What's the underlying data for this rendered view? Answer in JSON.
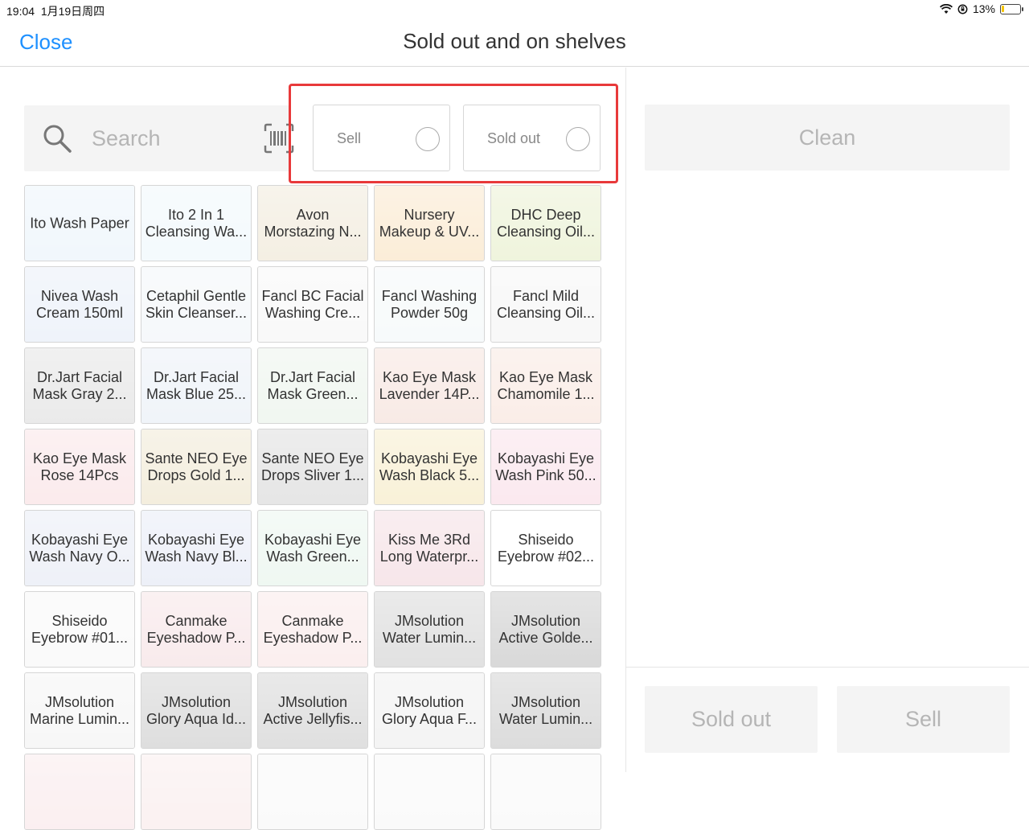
{
  "status_bar": {
    "time": "19:04",
    "date": "1月19日周四",
    "battery": "13%",
    "battery_level": 0.13
  },
  "nav": {
    "close_label": "Close",
    "title": "Sold out and on shelves"
  },
  "search": {
    "placeholder": "Search"
  },
  "filters": [
    {
      "label": "Sell",
      "selected": false
    },
    {
      "label": "Sold out",
      "selected": false
    }
  ],
  "right_panel": {
    "clean_label": "Clean",
    "sold_out_label": "Sold out",
    "sell_label": "Sell"
  },
  "products": [
    {
      "name": "Ito Wash Paper",
      "tint": "#cfe4f5"
    },
    {
      "name": "Ito 2 In 1\nCleansing Wa...",
      "tint": "#d8ecf7"
    },
    {
      "name": "Avon\nMorstazing N...",
      "tint": "#d9c8a0"
    },
    {
      "name": "Nursery\nMakeup & UV...",
      "tint": "#f2c27a"
    },
    {
      "name": "DHC Deep\nCleansing Oil...",
      "tint": "#c9d98a"
    },
    {
      "name": "Nivea Wash\nCream 150ml",
      "tint": "#c7d6ee"
    },
    {
      "name": "Cetaphil Gentle\nSkin Cleanser...",
      "tint": "#dfe8f0"
    },
    {
      "name": "Fancl BC Facial\nWashing Cre...",
      "tint": "#eaeaea"
    },
    {
      "name": "Fancl Washing\nPowder 50g",
      "tint": "#e4eef0"
    },
    {
      "name": "Fancl Mild\nCleansing Oil...",
      "tint": "#e6e6e6"
    },
    {
      "name": "Dr.Jart Facial\nMask Gray 2...",
      "tint": "#b8b8b8"
    },
    {
      "name": "Dr.Jart Facial\nMask Blue 25...",
      "tint": "#cbd9ea"
    },
    {
      "name": "Dr.Jart Facial\nMask Green...",
      "tint": "#cfe3cf"
    },
    {
      "name": "Kao Eye Mask\nLavender 14P...",
      "tint": "#e7b8a8"
    },
    {
      "name": "Kao Eye Mask\nChamomile 1...",
      "tint": "#eec3b0"
    },
    {
      "name": "Kao Eye Mask\nRose 14Pcs",
      "tint": "#f0b9c0"
    },
    {
      "name": "Sante NEO Eye\nDrops Gold 1...",
      "tint": "#d8c58f"
    },
    {
      "name": "Sante NEO Eye\nDrops Sliver 1...",
      "tint": "#a8a8a8"
    },
    {
      "name": "Kobayashi Eye\nWash Black 5...",
      "tint": "#e9d07a"
    },
    {
      "name": "Kobayashi Eye\nWash Pink 50...",
      "tint": "#f0b3c8"
    },
    {
      "name": "Kobayashi Eye\nWash Navy O...",
      "tint": "#c6cfe6"
    },
    {
      "name": "Kobayashi Eye\nWash Navy Bl...",
      "tint": "#c2cce8"
    },
    {
      "name": "Kobayashi Eye\nWash Green...",
      "tint": "#c9e6d3"
    },
    {
      "name": "Kiss Me 3Rd\nLong Waterpr...",
      "tint": "#e3aab7"
    },
    {
      "name": "Shiseido\nEyebrow #02...",
      "tint": "#ffffff"
    },
    {
      "name": "Shiseido\nEyebrow #01...",
      "tint": "#ededed"
    },
    {
      "name": "Canmake\nEyeshadow P...",
      "tint": "#e8b9bf"
    },
    {
      "name": "Canmake\nEyeshadow P...",
      "tint": "#f0c7c7"
    },
    {
      "name": "JMsolution\nWater Lumin...",
      "tint": "#9a9a9a"
    },
    {
      "name": "JMsolution\nActive Golde...",
      "tint": "#7d7d7d"
    },
    {
      "name": "JMsolution\nMarine Lumin...",
      "tint": "#e4e4e4"
    },
    {
      "name": "JMsolution\nGlory Aqua Id...",
      "tint": "#8f8f8f"
    },
    {
      "name": "JMsolution\nActive Jellyfis...",
      "tint": "#949494"
    },
    {
      "name": "JMsolution\nGlory Aqua F...",
      "tint": "#d8d8d8"
    },
    {
      "name": "JMsolution\nWater Lumin...",
      "tint": "#888888"
    },
    {
      "name": "",
      "tint": "#f0c9cd"
    },
    {
      "name": "",
      "tint": "#f0d0d0"
    },
    {
      "name": "",
      "tint": "#eeeeee"
    },
    {
      "name": "",
      "tint": "#eeeeee"
    },
    {
      "name": "",
      "tint": "#eeeeee"
    }
  ]
}
